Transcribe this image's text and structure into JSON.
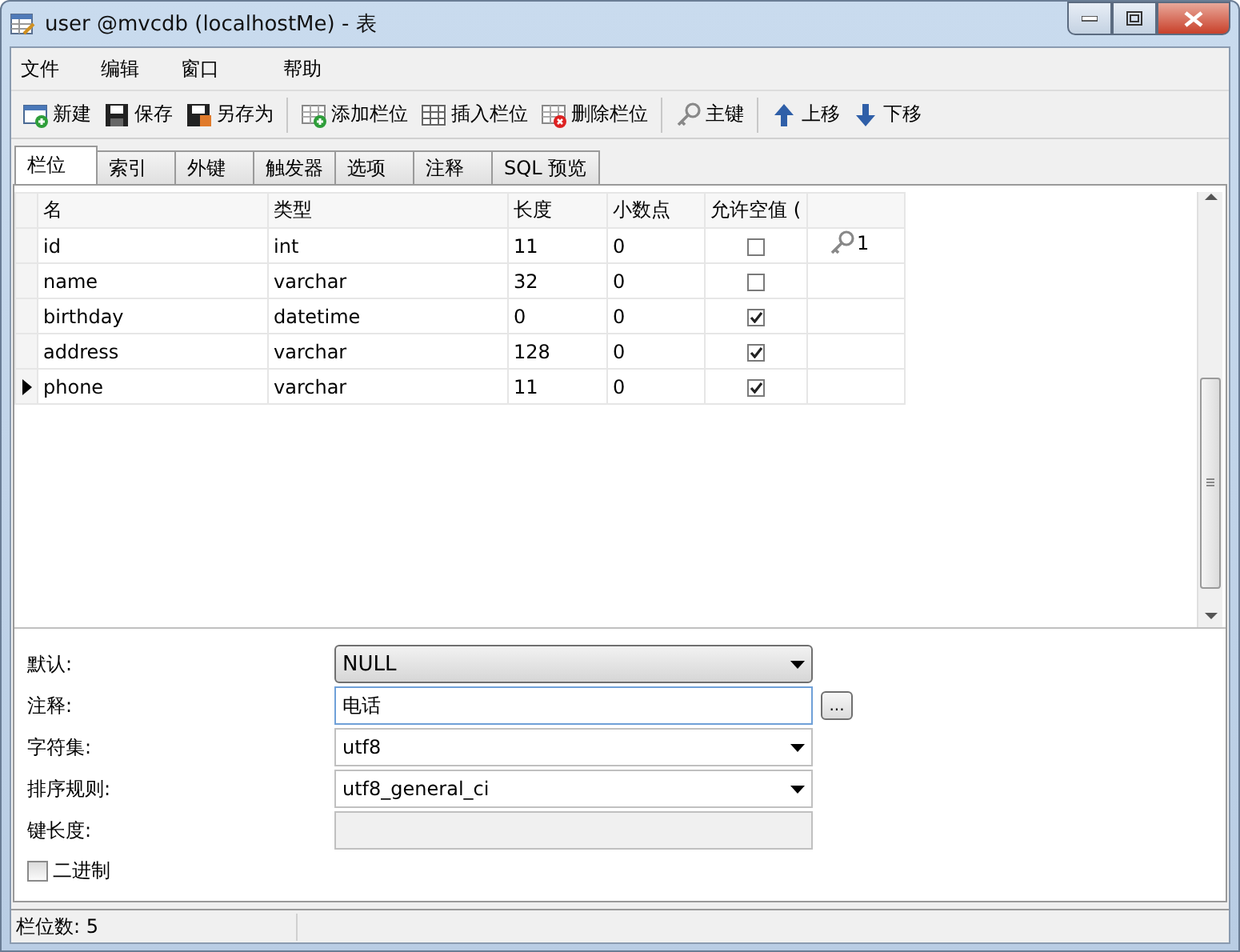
{
  "window": {
    "title": "user @mvcdb (localhostMe) - 表"
  },
  "menu": [
    "文件",
    "编辑",
    "窗口",
    "帮助"
  ],
  "toolbar": [
    {
      "kind": "button",
      "label": "新建"
    },
    {
      "kind": "button",
      "label": "保存"
    },
    {
      "kind": "button",
      "label": "另存为"
    },
    {
      "kind": "separator"
    },
    {
      "kind": "button",
      "label": "添加栏位"
    },
    {
      "kind": "button",
      "label": "插入栏位"
    },
    {
      "kind": "button",
      "label": "删除栏位"
    },
    {
      "kind": "separator"
    },
    {
      "kind": "button",
      "label": "主键"
    },
    {
      "kind": "separator"
    },
    {
      "kind": "button",
      "label": "上移"
    },
    {
      "kind": "button",
      "label": "下移"
    }
  ],
  "tabs": [
    {
      "label": "栏位",
      "selected": true
    },
    {
      "label": "索引",
      "selected": false
    },
    {
      "label": "外键",
      "selected": false
    },
    {
      "label": "触发器",
      "selected": false
    },
    {
      "label": "选项",
      "selected": false
    },
    {
      "label": "注释",
      "selected": false
    },
    {
      "label": "SQL 预览",
      "selected": false
    }
  ],
  "table": {
    "columns": [
      "名",
      "类型",
      "长度",
      "小数点",
      "允许空值 ("
    ],
    "rows": [
      {
        "name": "id",
        "type": "int",
        "length": "11",
        "decimals": "0",
        "allow_null": false,
        "key": "1",
        "selected": false
      },
      {
        "name": "name",
        "type": "varchar",
        "length": "32",
        "decimals": "0",
        "allow_null": false,
        "selected": false
      },
      {
        "name": "birthday",
        "type": "datetime",
        "length": "0",
        "decimals": "0",
        "allow_null": true,
        "selected": false
      },
      {
        "name": "address",
        "type": "varchar",
        "length": "128",
        "decimals": "0",
        "allow_null": true,
        "selected": false
      },
      {
        "name": "phone",
        "type": "varchar",
        "length": "11",
        "decimals": "0",
        "allow_null": true,
        "selected": true
      }
    ]
  },
  "properties": [
    {
      "kind": "combo",
      "label": "默认:",
      "value": "NULL"
    },
    {
      "kind": "text",
      "label": "注释:",
      "value": "电话",
      "button": "..."
    },
    {
      "kind": "select",
      "label": "字符集:",
      "value": "utf8"
    },
    {
      "kind": "select",
      "label": "排序规则:",
      "value": "utf8_general_ci"
    },
    {
      "kind": "disabled",
      "label": "键长度:"
    }
  ],
  "binary": {
    "label": "二进制",
    "checked": false
  },
  "status_bar": "栏位数: 5"
}
